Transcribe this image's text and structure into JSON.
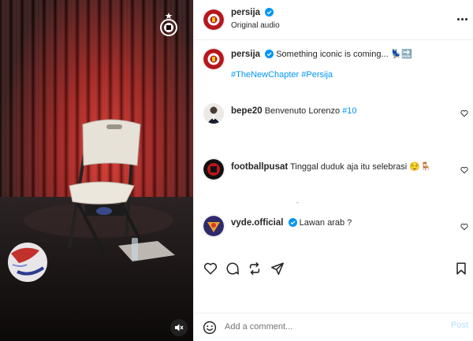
{
  "post": {
    "account": "persija",
    "subtitle": "Original audio",
    "more_label": "More options"
  },
  "caption": {
    "username": "persija",
    "text": "Something iconic is coming... 💺🔜",
    "hashtags": "#TheNewChapter #Persija"
  },
  "comments": [
    {
      "username": "bepe20",
      "text": "Benvenuto Lorenzo ",
      "tag": "#10"
    },
    {
      "username": "footballpusat",
      "text": "Tinggal duduk aja itu selebrasi 😌🪑"
    },
    {
      "username": "vyde.official",
      "text": "Lawan arab ?"
    }
  ],
  "composer": {
    "placeholder": "Add a comment...",
    "post_label": "Post"
  },
  "colors": {
    "brand_red": "#b5171d",
    "link_blue": "#00376b",
    "hashtag_blue": "#0095f6",
    "verified_blue": "#0095f6",
    "post_disabled": "#b2dffc"
  },
  "icons": {
    "header_more": "ellipsis-icon",
    "like": "heart-icon",
    "comment": "speech-bubble-icon",
    "share": "repost-icon",
    "send": "paper-plane-icon",
    "save": "bookmark-icon",
    "emoji": "smiley-icon",
    "mute": "speaker-muted-icon",
    "club_badge": "club-crest-icon"
  }
}
